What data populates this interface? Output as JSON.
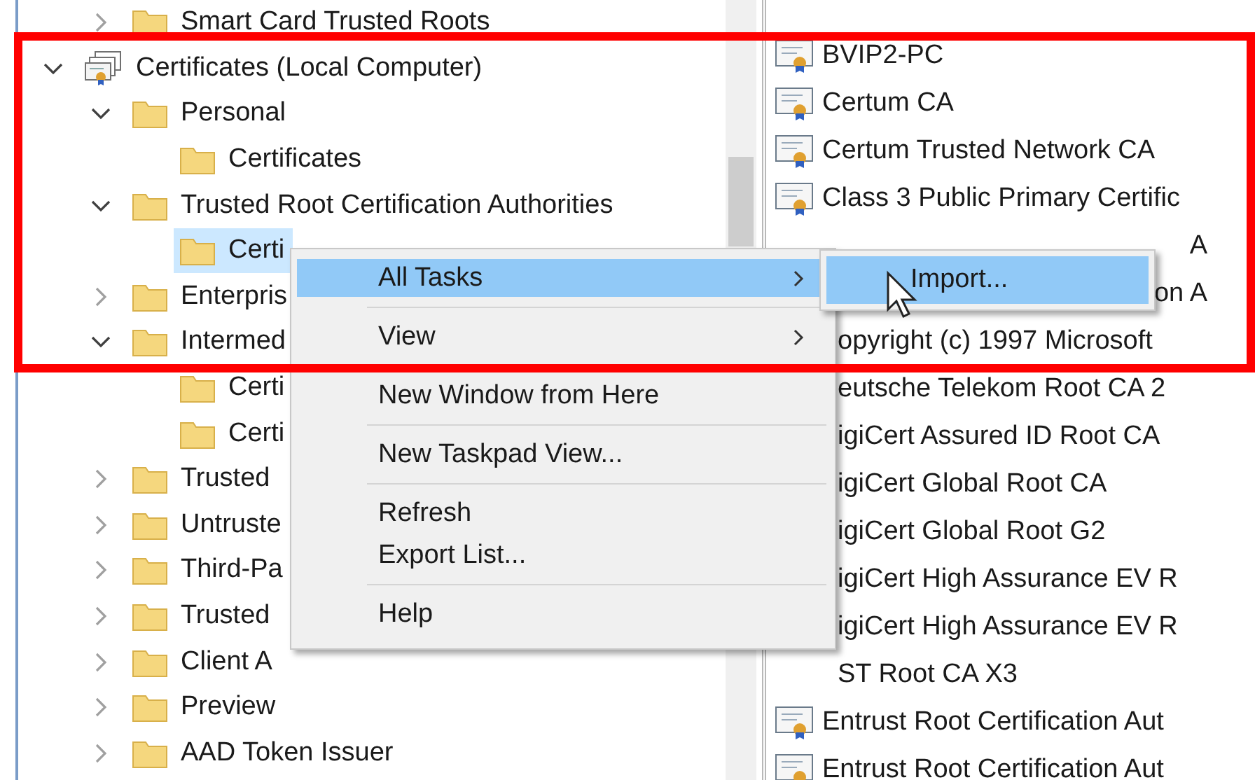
{
  "annotation": {
    "kind": "rectangle"
  },
  "cut_off_item": {
    "label": "Smart Card Trusted Roots",
    "expanded": false
  },
  "tree": [
    {
      "label": "Certificates (Local Computer)",
      "kind": "computer",
      "expanded": true,
      "selected": false,
      "children": [
        {
          "label": "Personal",
          "kind": "folder",
          "expanded": true,
          "selected": false,
          "children": [
            {
              "label": "Certificates",
              "kind": "folder",
              "selected": false
            }
          ]
        },
        {
          "label": "Trusted Root Certification Authorities",
          "kind": "folder",
          "expanded": true,
          "selected": false,
          "children": [
            {
              "label": "Certi",
              "kind": "folder",
              "selected": true
            }
          ]
        },
        {
          "label": "Enterpris",
          "kind": "folder",
          "expanded": false,
          "selected": false
        },
        {
          "label": "Intermed",
          "kind": "folder",
          "expanded": true,
          "selected": false,
          "children": [
            {
              "label": "Certi",
              "kind": "folder",
              "selected": false
            },
            {
              "label": "Certi",
              "kind": "folder",
              "selected": false
            }
          ]
        },
        {
          "label": "Trusted",
          "kind": "folder",
          "expanded": false,
          "selected": false
        },
        {
          "label": "Untruste",
          "kind": "folder",
          "expanded": false,
          "selected": false
        },
        {
          "label": "Third-Pa",
          "kind": "folder",
          "expanded": false,
          "selected": false
        },
        {
          "label": "Trusted",
          "kind": "folder",
          "expanded": false,
          "selected": false
        },
        {
          "label": "Client A",
          "kind": "folder",
          "expanded": false,
          "selected": false
        },
        {
          "label": "Preview",
          "kind": "folder",
          "expanded": false,
          "selected": false
        },
        {
          "label": "AAD Token Issuer",
          "kind": "folder",
          "expanded": false,
          "selected": false
        }
      ]
    }
  ],
  "list": [
    {
      "text": "BVIP2-PC",
      "kind": "full"
    },
    {
      "text": "Certum CA",
      "kind": "full"
    },
    {
      "text": "Certum Trusted Network CA",
      "kind": "full"
    },
    {
      "text": "Class 3 Public Primary Certific",
      "kind": "full"
    },
    {
      "text": "A",
      "kind": "end_only"
    },
    {
      "text": "on A",
      "kind": "end_only"
    },
    {
      "text": "opyright (c) 1997 Microsoft",
      "kind": "start_hidden"
    },
    {
      "text": "eutsche Telekom Root CA 2",
      "kind": "start_hidden"
    },
    {
      "text": "igiCert Assured ID Root CA",
      "kind": "start_hidden"
    },
    {
      "text": "igiCert Global Root CA",
      "kind": "start_hidden"
    },
    {
      "text": "igiCert Global Root G2",
      "kind": "start_hidden"
    },
    {
      "text": "igiCert High Assurance EV R",
      "kind": "start_hidden"
    },
    {
      "text": "igiCert High Assurance EV R",
      "kind": "start_hidden"
    },
    {
      "text": "ST Root CA X3",
      "kind": "start_hidden"
    },
    {
      "text": "Entrust Root Certification Aut",
      "kind": "full"
    },
    {
      "text": "Entrust Root Certification Aut",
      "kind": "full"
    }
  ],
  "context_menu": [
    {
      "kind": "item",
      "label": "All Tasks",
      "submenu": true,
      "selected": true
    },
    {
      "kind": "separator"
    },
    {
      "kind": "item",
      "label": "View",
      "submenu": true,
      "selected": false
    },
    {
      "kind": "separator"
    },
    {
      "kind": "item",
      "label": "New Window from Here",
      "submenu": false,
      "selected": false
    },
    {
      "kind": "separator"
    },
    {
      "kind": "item",
      "label": "New Taskpad View...",
      "submenu": false,
      "selected": false
    },
    {
      "kind": "separator"
    },
    {
      "kind": "item",
      "label": "Refresh",
      "submenu": false,
      "selected": false
    },
    {
      "kind": "item",
      "label": "Export List...",
      "submenu": false,
      "selected": false
    },
    {
      "kind": "separator"
    },
    {
      "kind": "item",
      "label": "Help",
      "submenu": false,
      "selected": false
    }
  ],
  "submenu": [
    {
      "label": "Import...",
      "selected": true
    }
  ]
}
